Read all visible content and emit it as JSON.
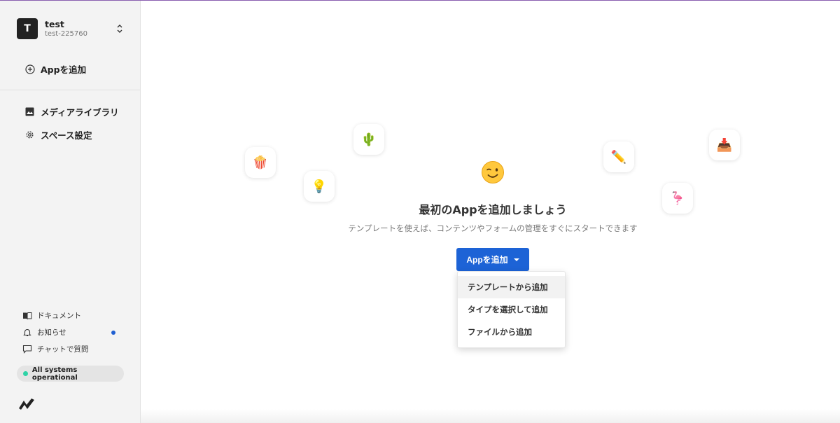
{
  "space": {
    "avatar_letter": "T",
    "name": "test",
    "id": "test-225760"
  },
  "sidebar": {
    "add_app_label": "Appを追加",
    "nav": [
      {
        "label": "メディアライブラリ",
        "icon": "image-icon"
      },
      {
        "label": "スペース設定",
        "icon": "gear-icon"
      }
    ],
    "footer": [
      {
        "label": "ドキュメント",
        "icon": "book-icon"
      },
      {
        "label": "お知らせ",
        "icon": "bell-icon"
      },
      {
        "label": "チャットで質問",
        "icon": "chat-icon"
      }
    ],
    "status_label": "All systems operational"
  },
  "main": {
    "decor_emojis": [
      "🍿",
      "💡",
      "🌵",
      "✏️",
      "🦩",
      "📥"
    ],
    "title": "最初のAppを追加しましょう",
    "description": "テンプレートを使えば、コンテンツやフォームの管理をすぐにスタートできます",
    "add_button_label": "Appを追加",
    "dropdown": [
      "テンプレートから追加",
      "タイプを選択して追加",
      "ファイルから追加"
    ]
  },
  "colors": {
    "primary": "#1d63d6",
    "status_green": "#2ed3a6",
    "notification_dot": "#1f5fd1"
  }
}
